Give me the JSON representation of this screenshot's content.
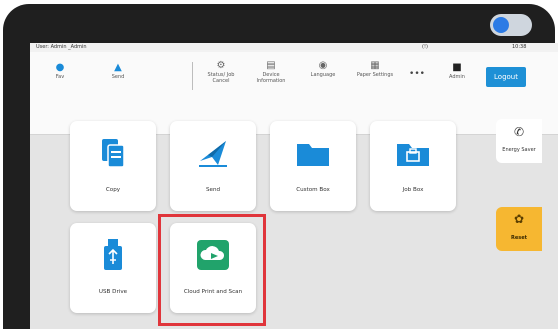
{
  "status": {
    "user": "User: Admin _Admin",
    "middle": "(!)",
    "time": "10:38"
  },
  "toolbar": {
    "fav_label": "Fav",
    "send_label": "Send",
    "status_label": "Status/ Job Cancel",
    "device_info_label": "Device Information",
    "language_label": "Language",
    "paper_settings_label": "Paper Settings",
    "more_label": "•••",
    "admin_label": "Admin",
    "logout_label": "Logout"
  },
  "tiles": [
    {
      "label": "Copy"
    },
    {
      "label": "Send"
    },
    {
      "label": "Custom Box"
    },
    {
      "label": "Job Box"
    },
    {
      "label": "USB Drive"
    },
    {
      "label": "Cloud Print and Scan"
    }
  ],
  "side": {
    "energy_label": "Energy Saver",
    "reset_label": "Reset"
  },
  "colors": {
    "accent_blue": "#1e90d6",
    "icon_blue": "#1a8bd8",
    "cloud_green": "#21a36b",
    "reset_yellow": "#f6b731",
    "highlight_red": "#e0353b"
  }
}
